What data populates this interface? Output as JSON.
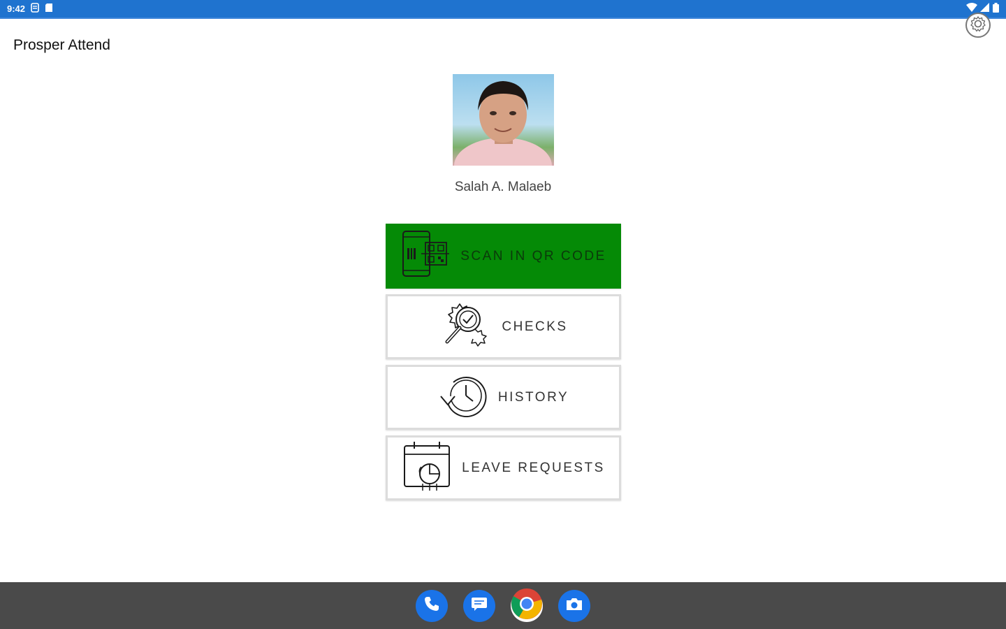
{
  "status_bar": {
    "time": "9:42"
  },
  "app_bar": {
    "title": "Prosper Attend"
  },
  "profile": {
    "name": "Salah A. Malaeb"
  },
  "menu": {
    "items": [
      {
        "label": "SCAN IN QR CODE",
        "icon": "qr-scan-icon",
        "color": "#058a06"
      },
      {
        "label": "CHECKS",
        "icon": "gear-search-icon"
      },
      {
        "label": "HISTORY",
        "icon": "history-clock-icon"
      },
      {
        "label": "LEAVE REQUESTS",
        "icon": "calendar-chart-icon"
      }
    ]
  },
  "dock": {
    "apps": [
      "phone-icon",
      "messages-icon",
      "chrome-icon",
      "camera-icon"
    ]
  },
  "colors": {
    "status_bar": "#1f73cf",
    "primary_button": "#058a06",
    "nav_bar": "#4a4a4a"
  }
}
